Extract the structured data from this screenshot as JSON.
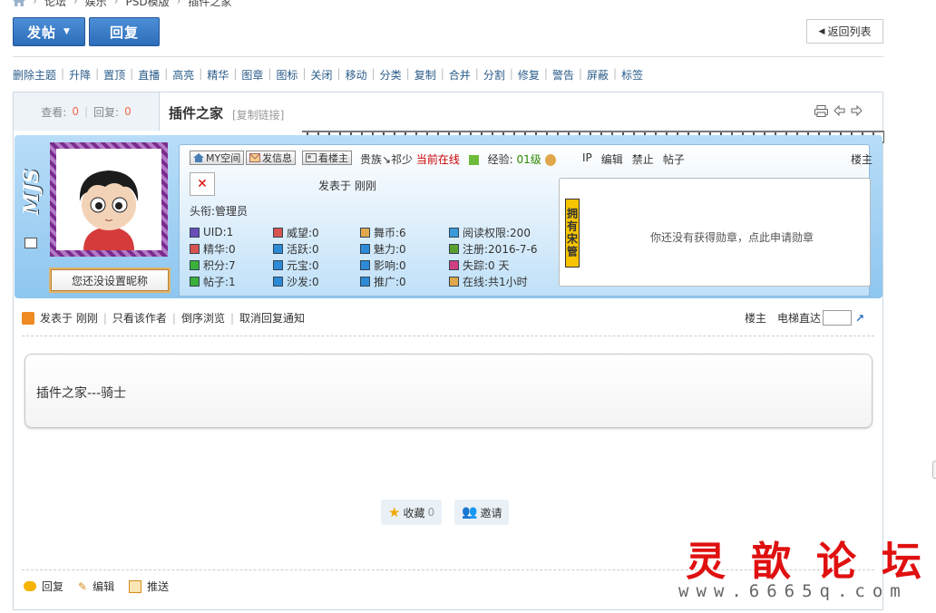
{
  "breadcrumb": [
    "论坛",
    "娱乐",
    "PSD模版",
    "插件之家"
  ],
  "toolbar": {
    "post_label": "发帖",
    "reply_label": "回复",
    "back_label": "返回列表"
  },
  "mod_actions": [
    "删除主题",
    "升降",
    "置顶",
    "直播",
    "高亮",
    "精华",
    "图章",
    "图标",
    "关闭",
    "移动",
    "分类",
    "复制",
    "合并",
    "分割",
    "修复",
    "警告",
    "屏蔽",
    "标签"
  ],
  "thread": {
    "views_label": "查看:",
    "views": "0",
    "replies_label": "回复:",
    "replies": "0",
    "title": "插件之家",
    "copy_link": "[复制链接]"
  },
  "author": {
    "logo_text": "MJS",
    "nickname_button": "您还没设置昵称",
    "buttons": [
      "MY空间",
      "发信息",
      "看楼主"
    ],
    "status_prefix": "贵族↘祁少",
    "online_text": "当前在线",
    "exp_label": "经验:",
    "exp_value": "01级",
    "admin_links": [
      "IP",
      "编辑",
      "禁止",
      "帖子"
    ],
    "floor": "楼主",
    "posted_at": "发表于 刚刚",
    "rank_title": "头衔:管理员",
    "stats": [
      "UID:1",
      "威望:0",
      "舞币:6",
      "阅读权限:200",
      "精华:0",
      "活跃:0",
      "魅力:0",
      "注册:2016-7-6",
      "积分:7",
      "元宝:0",
      "影响:0",
      "失踪:0 天",
      "帖子:1",
      "沙发:0",
      "推广:0",
      "在线:共1小时"
    ],
    "medal_tab": "拥有宋管",
    "medal_text": "你还没有获得勋章，点此申请勋章"
  },
  "post_toolbar": {
    "posted": "发表于 刚刚",
    "author_only": "只看该作者",
    "reverse": "倒序浏览",
    "cancel_notify": "取消回复通知",
    "floor": "楼主",
    "jump_label": "电梯直达"
  },
  "post": {
    "content": "插件之家---骑士"
  },
  "interact": {
    "favorite_label": "收藏",
    "favorite_count": "0",
    "invite_label": "邀请"
  },
  "bottom_actions": [
    "回复",
    "编辑",
    "推送"
  ],
  "watermark": {
    "title": "灵歆论坛",
    "url": "www.6665q.com"
  },
  "colors": {
    "accent_blue": "#2c6cb9",
    "panel_blue": "#8ec6ef",
    "count_orange": "#f26c4f",
    "online_red": "#cc0000",
    "watermark_red": "#e01010"
  }
}
